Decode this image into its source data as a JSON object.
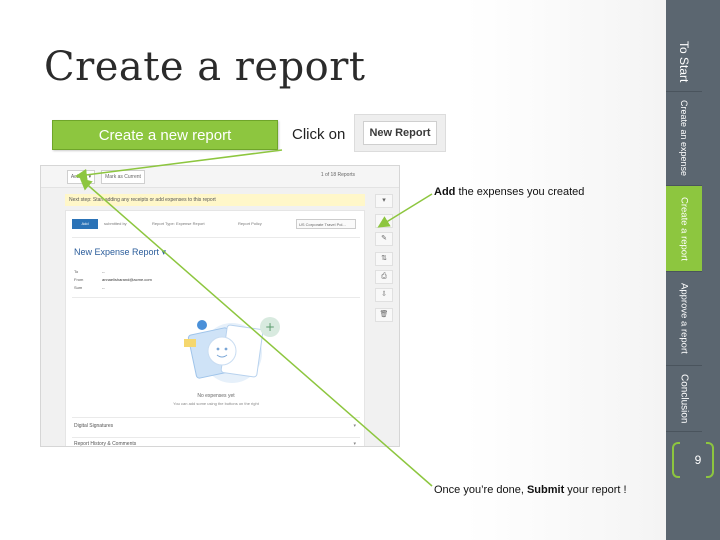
{
  "slide": {
    "title": "Create a report",
    "create_button_label": "Create a new report",
    "click_on_text": "Click on",
    "new_report_label": "New Report",
    "add_bold": "Add",
    "add_rest": " the expenses you created",
    "done_prefix": "Once you’re done, ",
    "done_bold": "Submit",
    "done_suffix": " your report !"
  },
  "screenshot": {
    "toolbar_buttons": [
      "Actions ▾",
      "Mark as Current"
    ],
    "pager": "1 of 18 Reports",
    "notice": "Next step: Start adding any receipts or add expenses to this report",
    "blue_button": "Add",
    "meta_left": "submitted by",
    "meta_right": "Report Type: Expense Report",
    "policy_label": "Report Policy",
    "policy_value": "US Corporate Travel Pol...",
    "report_title": "New Expense Report ▾",
    "fields": [
      {
        "label": "To",
        "value": "--"
      },
      {
        "label": "From",
        "value": "annaelisharand@acme.com"
      },
      {
        "label": "Sum",
        "value": "--"
      }
    ],
    "no_expenses": "No expenses yet",
    "no_expenses_sub": "You can add some using the buttons on the right",
    "section_signatures": "Digital Signatures",
    "section_history": "Report History & Comments",
    "side_tools": [
      "▾",
      "+",
      "✎",
      "⇅",
      "⎙",
      "⇩",
      "🗑"
    ]
  },
  "sidebar": {
    "tabs": [
      "To Start",
      "Create an expense",
      "Create a report",
      "Approve a report",
      "Conclusion"
    ],
    "active_index": 2,
    "page_number": "9"
  },
  "colors": {
    "accent_green": "#8dc63f",
    "sidebar_gray": "#5b6670"
  }
}
